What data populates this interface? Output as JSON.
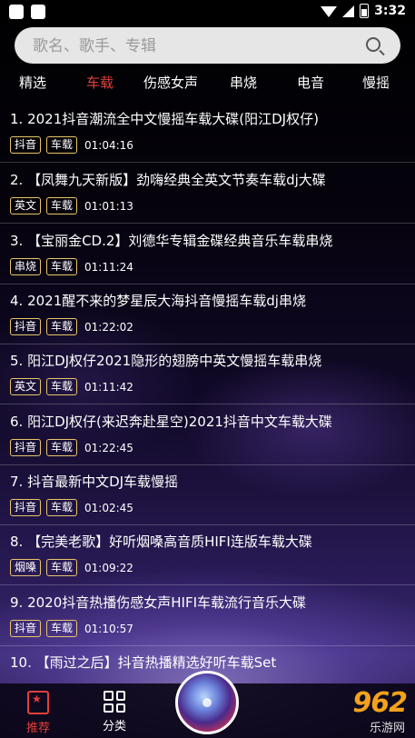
{
  "status": {
    "time": "3:32"
  },
  "search": {
    "placeholder": "歌名、歌手、专辑"
  },
  "tabs": [
    {
      "label": "精选",
      "active": false
    },
    {
      "label": "车载",
      "active": true
    },
    {
      "label": "伤感女声",
      "active": false
    },
    {
      "label": "串烧",
      "active": false
    },
    {
      "label": "电音",
      "active": false
    },
    {
      "label": "慢摇",
      "active": false
    }
  ],
  "songs": [
    {
      "title": "1. 2021抖音潮流全中文慢摇车载大碟(阳江DJ权仔)",
      "tags": [
        "抖音",
        "车载"
      ],
      "duration": "01:04:16"
    },
    {
      "title": "2. 【凤舞九天新版】劲嗨经典全英文节奏车载dj大碟",
      "tags": [
        "英文",
        "车载"
      ],
      "duration": "01:01:13"
    },
    {
      "title": "3. 【宝丽金CD.2】刘德华专辑金碟经典音乐车载串烧",
      "tags": [
        "串烧",
        "车载"
      ],
      "duration": "01:11:24"
    },
    {
      "title": "4. 2021醒不来的梦星辰大海抖音慢摇车载dj串烧",
      "tags": [
        "抖音",
        "车载"
      ],
      "duration": "01:22:02"
    },
    {
      "title": "5. 阳江DJ权仔2021隐形的翅膀中英文慢摇车载串烧",
      "tags": [
        "英文",
        "车载"
      ],
      "duration": "01:11:42"
    },
    {
      "title": "6. 阳江DJ权仔(来迟奔赴星空)2021抖音中文车载大碟",
      "tags": [
        "抖音",
        "车载"
      ],
      "duration": "01:22:45"
    },
    {
      "title": "7. 抖音最新中文DJ车载慢摇",
      "tags": [
        "抖音",
        "车载"
      ],
      "duration": "01:02:45"
    },
    {
      "title": "8. 【完美老歌】好听烟嗓高音质HIFI连版车载大碟",
      "tags": [
        "烟嗓",
        "车载"
      ],
      "duration": "01:09:22"
    },
    {
      "title": "9. 2020抖音热播伤感女声HIFI车载流行音乐大碟",
      "tags": [
        "抖音",
        "车载"
      ],
      "duration": "01:10:57"
    },
    {
      "title": "10. 【雨过之后】抖音热播精选好听车载Set",
      "tags": [],
      "duration": ""
    }
  ],
  "bottom_nav": {
    "recommend_label": "推荐",
    "category_label": "分类"
  },
  "watermark": {
    "brand": "962",
    "site": "乐游网"
  },
  "colors": {
    "accent": "#e0403a",
    "tag_border": "#e8c566"
  }
}
